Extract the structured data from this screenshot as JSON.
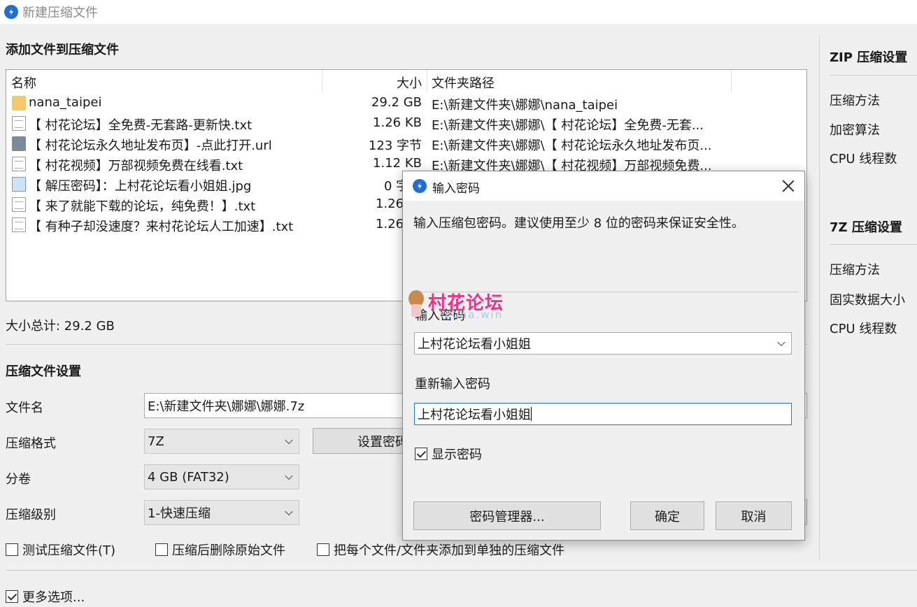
{
  "window": {
    "title": "新建压缩文件"
  },
  "add_section": {
    "title": "添加文件到压缩文件",
    "columns": {
      "name": "名称",
      "size": "大小",
      "path": "文件夹路径"
    },
    "files": [
      {
        "icon": "folder-icon",
        "name": "nana_taipei",
        "size": "29.2 GB",
        "path": "E:\\新建文件夹\\娜娜\\nana_taipei"
      },
      {
        "icon": "text-file-icon",
        "name": "【 村花论坛】全免费-无套路-更新快.txt",
        "size": "1.26 KB",
        "path": "E:\\新建文件夹\\娜娜\\【 村花论坛】全免费-无套..."
      },
      {
        "icon": "url-file-icon",
        "name": "【 村花论坛永久地址发布页】-点此打开.url",
        "size": "123 字节",
        "path": "E:\\新建文件夹\\娜娜\\【 村花论坛永久地址发布页..."
      },
      {
        "icon": "text-file-icon",
        "name": "【 村花视频】万部视频免费在线看.txt",
        "size": "1.12 KB",
        "path": "E:\\新建文件夹\\娜娜\\【 村花视频】万部视频免费..."
      },
      {
        "icon": "image-file-icon",
        "name": "【 解压密码】：上村花论坛看小姐姐.jpg",
        "size": "0 字",
        "path": ""
      },
      {
        "icon": "text-file-icon",
        "name": "【 来了就能下载的论坛，纯免费！】.txt",
        "size": "1.26",
        "path": ""
      },
      {
        "icon": "text-file-icon",
        "name": "【 有种子却没速度？来村花论坛人工加速】.txt",
        "size": "1.26",
        "path": ""
      }
    ],
    "total": "大小总计: 29.2 GB"
  },
  "settings": {
    "title": "压缩文件设置",
    "filename_label": "文件名",
    "filename_value": "E:\\新建文件夹\\娜娜\\娜娜.7z",
    "format_label": "压缩格式",
    "format_value": "7Z",
    "set_password_button": "设置密码",
    "volume_label": "分卷",
    "volume_value": "4 GB (FAT32)",
    "level_label": "压缩级别",
    "level_value": "1-快速压缩",
    "test_archive": "测试压缩文件(T)",
    "delete_after": "压缩后删除原始文件",
    "separate_archives": "把每个文件/文件夹添加到单独的压缩文件",
    "more_options": "更多选项..."
  },
  "right_panel": {
    "zip_title": "ZIP 压缩设置",
    "zip_items": [
      "压缩方法",
      "加密算法",
      "CPU 线程数"
    ],
    "sevenz_title": "7Z 压缩设置",
    "sevenz_items": [
      "压缩方法",
      "固实数据大小",
      "CPU 线程数"
    ]
  },
  "password_dialog": {
    "title": "输入密码",
    "description": "输入压缩包密码。建议使用至少 8 位的密码来保证安全性。",
    "watermark_main": "村花论坛",
    "watermark_sub": "cuna.win",
    "password_label": "输入密码",
    "password_value": "上村花论坛看小姐姐",
    "reenter_label": "重新输入密码",
    "reenter_value": "上村花论坛看小姐姐",
    "show_password": "显示密码",
    "manager_button": "密码管理器...",
    "ok_button": "确定",
    "cancel_button": "取消"
  }
}
